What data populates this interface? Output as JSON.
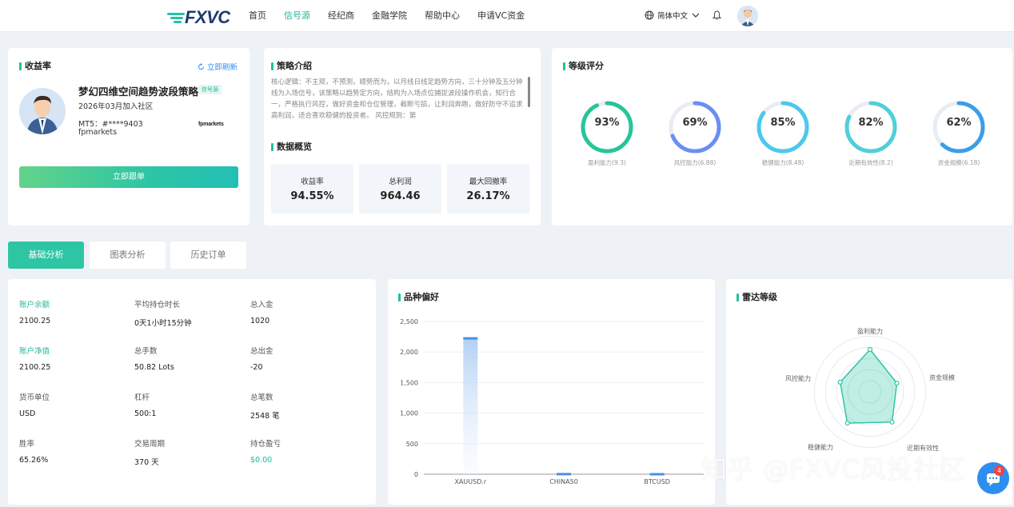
{
  "nav": {
    "logo": "FXVC",
    "items": [
      "首页",
      "信号源",
      "经纪商",
      "金融学院",
      "帮助中心",
      "申请VC资金"
    ],
    "active_index": 1,
    "language": "简体中文"
  },
  "profile": {
    "section_title": "收益率",
    "refresh_label": "立即刷新",
    "name": "梦幻四维空间趋势波段策略",
    "tag": "信号源",
    "joined": "2026年03月加入社区",
    "mt5": "MT5：#****9403",
    "broker": "fpmarkets",
    "broker_logo": "fpmarkets",
    "follow_button": "立即跟单"
  },
  "strategy": {
    "section_title": "策略介绍",
    "text": "核心逻辑：不主观，不预测，顺势而为，以月线日线定趋势方向，三十分钟及五分钟线为入场信号，该策略以趋势定方向，结构为入场点位捕捉波段操作机会，知行合一，严格执行风控，做好资金和仓位管理，截断亏损，让利润奔跑，做好防守不追求高利润，适合喜欢稳健的投资者。 风控规则：第",
    "overview_title": "数据概览",
    "overview": [
      {
        "label": "收益率",
        "value": "94.55%"
      },
      {
        "label": "总利润",
        "value": "964.46"
      },
      {
        "label": "最大回撤率",
        "value": "26.17%"
      }
    ]
  },
  "rating": {
    "section_title": "等级评分",
    "gauges": [
      {
        "value": "93%",
        "percent": 93,
        "label": "盈利能力(9.3)",
        "color": "#27c49a"
      },
      {
        "value": "69%",
        "percent": 69,
        "label": "风控能力(6.88)",
        "color": "#6b8ef5"
      },
      {
        "value": "85%",
        "percent": 85,
        "label": "稳健能力(8.48)",
        "color": "#4cc8ee"
      },
      {
        "value": "82%",
        "percent": 82,
        "label": "近期有效性(8.2)",
        "color": "#4fd0d8"
      },
      {
        "value": "62%",
        "percent": 62,
        "label": "资金规模(6.18)",
        "color": "#3a9ee8"
      }
    ]
  },
  "tabs": [
    "基础分析",
    "图表分析",
    "历史订单"
  ],
  "basic": {
    "stats": [
      {
        "label": "账户余额",
        "value": "2100.25",
        "highlight": true
      },
      {
        "label": "平均持仓时长",
        "value": "0天1小时15分钟"
      },
      {
        "label": "总入金",
        "value": "1020"
      },
      {
        "label": "账户净值",
        "value": "2100.25",
        "highlight": true
      },
      {
        "label": "总手数",
        "value": "50.82 Lots"
      },
      {
        "label": "总出金",
        "value": "-20"
      },
      {
        "label": "货币单位",
        "value": "USD"
      },
      {
        "label": "杠杆",
        "value": "500:1"
      },
      {
        "label": "总笔数",
        "value": "2548 笔"
      },
      {
        "label": "胜率",
        "value": "65.26%"
      },
      {
        "label": "交易周期",
        "value": "370 天"
      },
      {
        "label": "持仓盈亏",
        "value": "$0.00",
        "green": true
      }
    ]
  },
  "preference": {
    "section_title": "品种偏好",
    "chart_data": {
      "type": "bar",
      "categories": [
        "XAUUSD.r",
        "CHINA50",
        "BTCUSD"
      ],
      "values": [
        2230,
        8,
        6
      ],
      "ylim": [
        0,
        2500
      ],
      "yticks": [
        "0",
        "500",
        "1,000",
        "1,500",
        "2,000",
        "2,500"
      ],
      "ytick_values": [
        0,
        500,
        1000,
        1500,
        2000,
        2500
      ],
      "grid": true
    }
  },
  "radar": {
    "section_title": "雷达等级",
    "chart_data": {
      "type": "radar",
      "axes": [
        "盈利能力",
        "资金规模",
        "近期有效性",
        "稳健能力",
        "风控能力"
      ],
      "values": [
        9.3,
        6.18,
        8.2,
        8.48,
        6.88
      ],
      "max": 10
    }
  },
  "watermark": "知乎 @FXVC风投社区",
  "chat": {
    "badge": "4"
  }
}
